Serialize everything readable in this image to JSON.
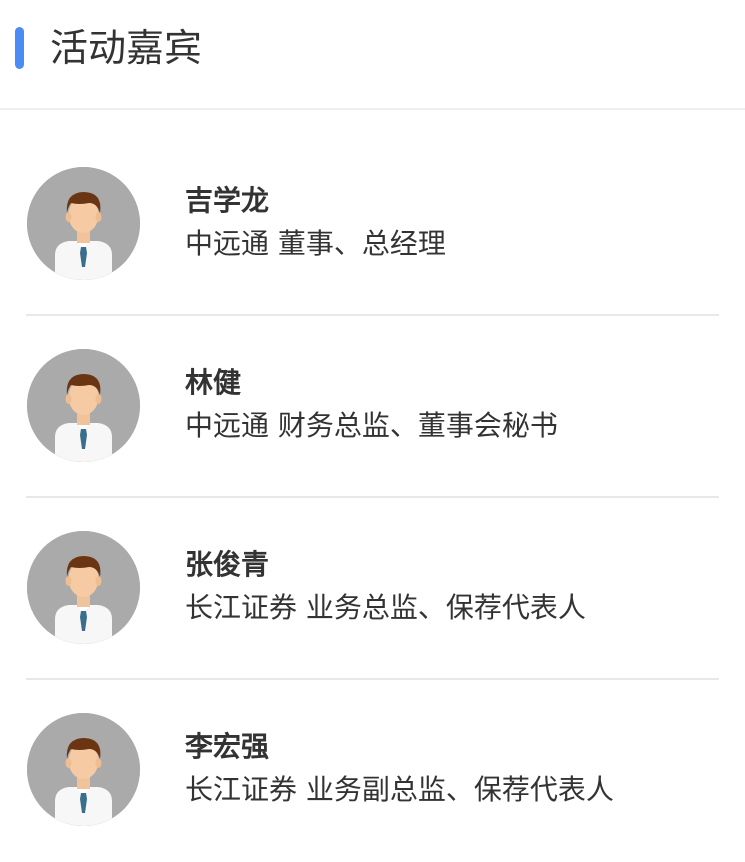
{
  "header": {
    "title": "活动嘉宾",
    "accent_color": "#4a8bf5"
  },
  "guests": [
    {
      "name": "吉学龙",
      "title": "中远通 董事、总经理",
      "avatar_icon": "male-avatar-icon"
    },
    {
      "name": "林健",
      "title": "中远通 财务总监、董事会秘书",
      "avatar_icon": "male-avatar-icon"
    },
    {
      "name": "张俊青",
      "title": "长江证券 业务总监、保荐代表人",
      "avatar_icon": "male-avatar-icon"
    },
    {
      "name": "李宏强",
      "title": "长江证券 业务副总监、保荐代表人",
      "avatar_icon": "male-avatar-icon"
    }
  ]
}
